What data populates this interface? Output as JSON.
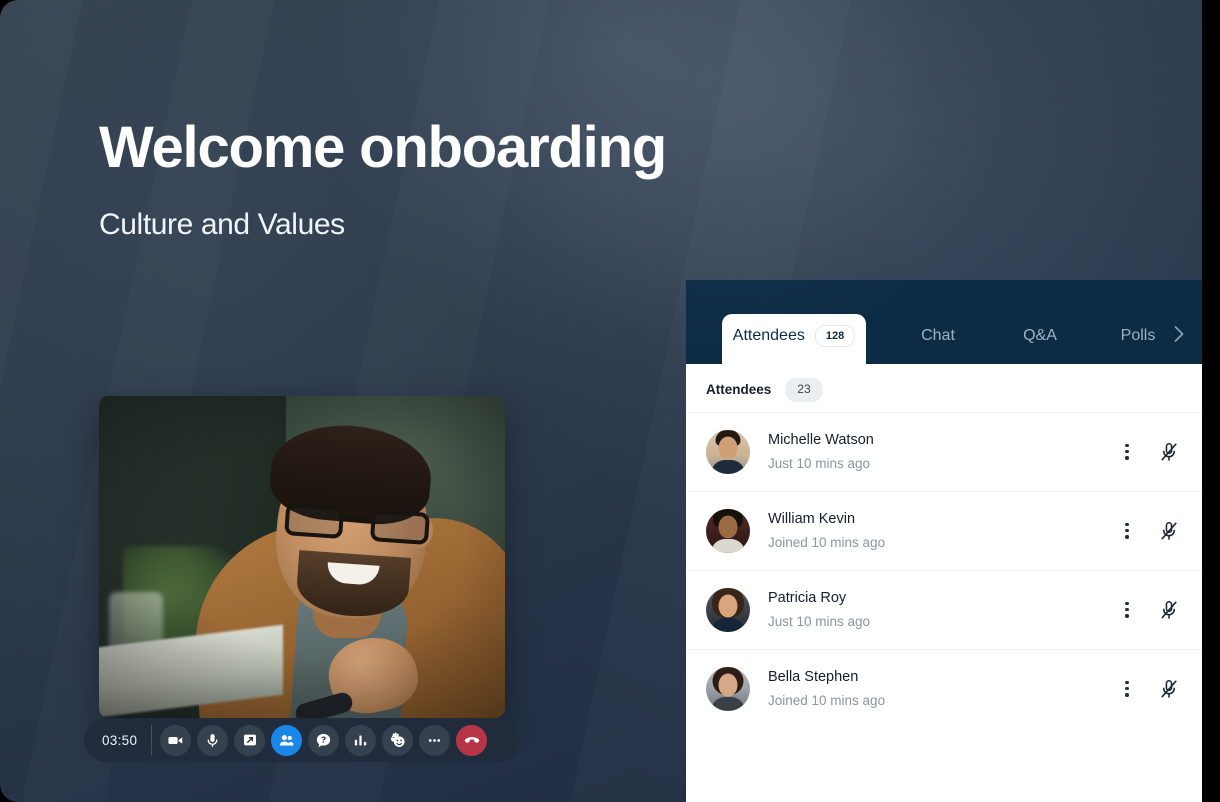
{
  "hero": {
    "title": "Welcome onboarding",
    "subtitle": "Culture and Values"
  },
  "video": {
    "timer": "03:50",
    "controls": [
      {
        "name": "camera",
        "icon": "video-camera-icon",
        "state": "default"
      },
      {
        "name": "microphone",
        "icon": "microphone-icon",
        "state": "default"
      },
      {
        "name": "share-screen",
        "icon": "share-screen-icon",
        "state": "default"
      },
      {
        "name": "participants",
        "icon": "people-icon",
        "state": "active"
      },
      {
        "name": "question-answer",
        "icon": "question-bubble-icon",
        "state": "default"
      },
      {
        "name": "polls",
        "icon": "bar-chart-icon",
        "state": "default"
      },
      {
        "name": "reactions",
        "icon": "raised-hand-smiley-icon",
        "state": "default"
      },
      {
        "name": "more-options",
        "icon": "ellipsis-icon",
        "state": "default"
      },
      {
        "name": "end-call",
        "icon": "phone-hangup-icon",
        "state": "danger"
      }
    ]
  },
  "panel": {
    "tabs": [
      {
        "label": "Attendees",
        "badge": "128",
        "active": true
      },
      {
        "label": "Chat",
        "badge": "",
        "active": false
      },
      {
        "label": "Q&A",
        "badge": "",
        "active": false
      },
      {
        "label": "Polls",
        "badge": "",
        "active": false
      }
    ],
    "next_icon": "chevron-right-icon",
    "list": {
      "header_label": "Attendees",
      "header_count": "23",
      "rows": [
        {
          "name": "Michelle Watson",
          "status": "Just 10 mins ago",
          "mic": "muted"
        },
        {
          "name": "William Kevin",
          "status": "Joined 10 mins ago",
          "mic": "muted"
        },
        {
          "name": "Patricia Roy",
          "status": "Just 10 mins ago",
          "mic": "muted"
        },
        {
          "name": "Bella Stephen",
          "status": "Joined 10 mins ago",
          "mic": "muted"
        }
      ]
    }
  },
  "colors": {
    "background_top": "#33414f",
    "background_bottom": "#1d2b41",
    "panel_header": "#0c2b45",
    "accent_blue": "#1a87e8",
    "danger_red": "#b73547",
    "panel_body": "#ffffff"
  }
}
